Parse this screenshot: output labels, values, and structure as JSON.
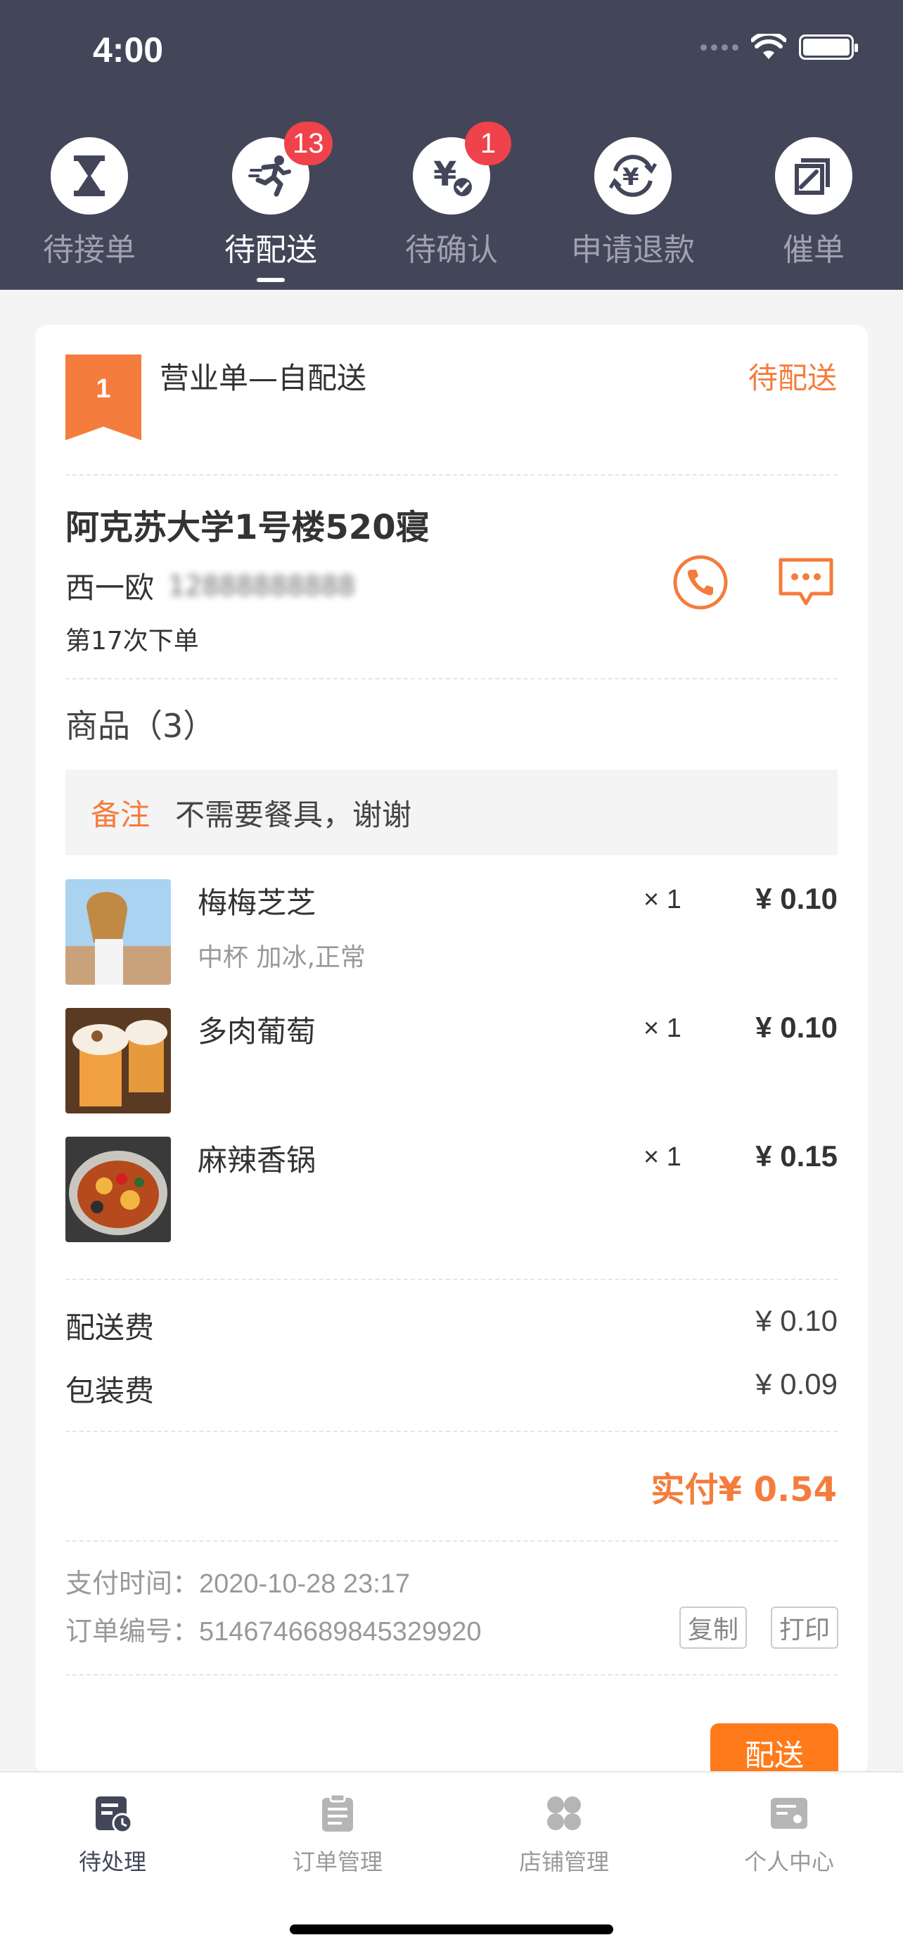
{
  "status_bar": {
    "time": "4:00"
  },
  "top_tabs": [
    {
      "label": "待接单",
      "icon": "hourglass-icon",
      "badge": ""
    },
    {
      "label": "待配送",
      "icon": "runner-icon",
      "badge": "13",
      "active": true
    },
    {
      "label": "待确认",
      "icon": "yen-check-icon",
      "badge": "1"
    },
    {
      "label": "申请退款",
      "icon": "yen-refund-icon",
      "badge": ""
    },
    {
      "label": "催单",
      "icon": "urge-icon",
      "badge": ""
    }
  ],
  "order": {
    "number": "1",
    "type": "营业单—自配送",
    "status": "待配送",
    "address": "阿克苏大学1号楼520寝",
    "customer_name": "西一欧",
    "customer_phone": "12888888888",
    "order_count_text": "第17次下单",
    "goods_title": "商品（3）",
    "remark_label": "备注",
    "remark_text": "不需要餐具，谢谢",
    "items": [
      {
        "name": "梅梅芝芝",
        "spec": "中杯 加冰,正常",
        "qty": "× 1",
        "price": "¥ 0.10"
      },
      {
        "name": "多肉葡萄",
        "spec": "",
        "qty": "× 1",
        "price": "¥ 0.10"
      },
      {
        "name": "麻辣香锅",
        "spec": "",
        "qty": "× 1",
        "price": "¥ 0.15"
      }
    ],
    "delivery_fee_label": "配送费",
    "delivery_fee": "¥ 0.10",
    "packing_fee_label": "包装费",
    "packing_fee": "¥ 0.09",
    "total": "实付¥ 0.54",
    "pay_time": "支付时间：2020-10-28 23:17",
    "order_no": "订单编号：5146746689845329920",
    "copy_label": "复制",
    "print_label": "打印",
    "deliver_label": "配送"
  },
  "bottom_nav": [
    {
      "label": "待处理",
      "active": true
    },
    {
      "label": "订单管理"
    },
    {
      "label": "店铺管理"
    },
    {
      "label": "个人中心"
    }
  ],
  "colors": {
    "header": "#434659",
    "accent": "#f47c3c",
    "badge": "#f0424a",
    "button": "#ff7a1a"
  }
}
